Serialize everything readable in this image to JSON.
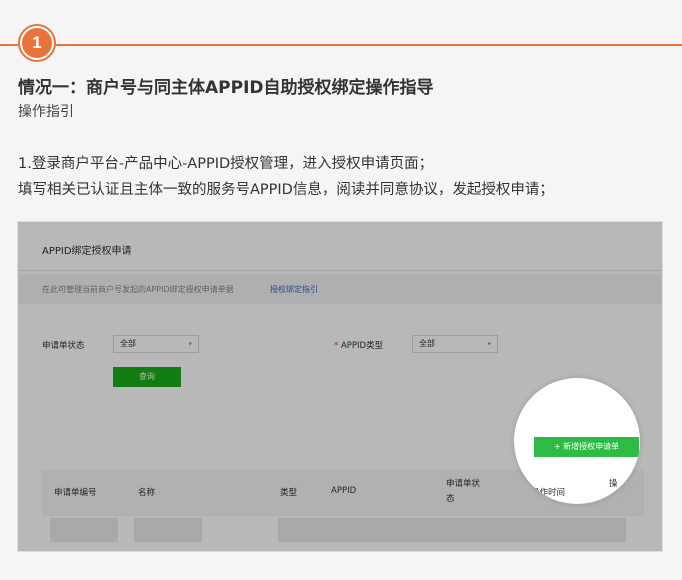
{
  "step": {
    "number": "1"
  },
  "heading": "情况一：商户号与同主体APPID自助授权绑定操作指导",
  "subheading": "操作指引",
  "instructions": [
    "1.登录商户平台-产品中心-APPID授权管理，进入授权申请页面；",
    "填写相关已认证且主体一致的服务号APPID信息，阅读并同意协议，发起授权申请；"
  ],
  "screenshot": {
    "title": "APPID绑定授权申请",
    "desc": "在此可管理当前商户号发起的APPID绑定授权申请单据",
    "desc_link": "授权绑定指引",
    "filter_status_label": "申请单状态",
    "filter_status_value": "全部",
    "filter_type_required": "*",
    "filter_type_label": "APPID类型",
    "filter_type_value": "全部",
    "query_button": "查询",
    "new_button": "+ 新增授权申请单",
    "table_headers": {
      "id": "申请单编号",
      "name": "名称",
      "type": "类型",
      "appid": "APPID",
      "status_line1": "申请单状",
      "status_line2": "态",
      "last_op": "最后操作时间",
      "op_line1": "操",
      "op_line2": "作"
    }
  },
  "colors": {
    "accent": "#e8743b",
    "green": "#1aad19",
    "link": "#3a6bc4"
  }
}
